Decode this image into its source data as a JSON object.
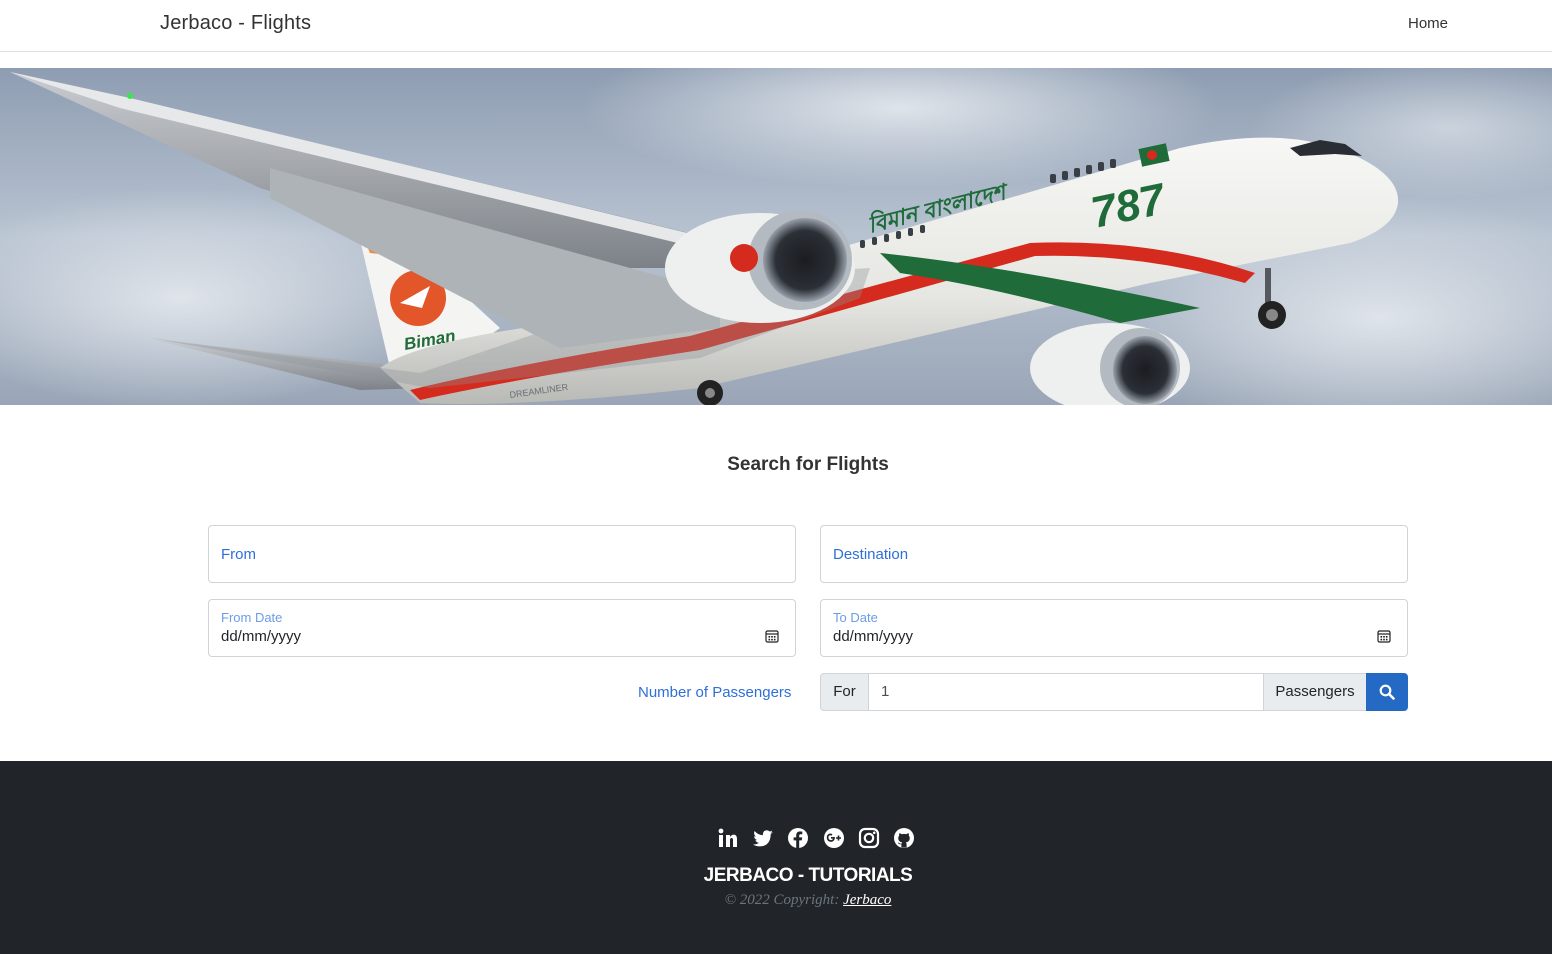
{
  "navbar": {
    "brand": "Jerbaco - Flights",
    "home_label": "Home"
  },
  "hero": {
    "tail_text": "Biman",
    "fuselage_text": "বিমান বাংলাদেশ",
    "model_text": "787",
    "engine_text": "DREAMLINER"
  },
  "search": {
    "title": "Search for Flights",
    "from_placeholder": "From",
    "destination_placeholder": "Destination",
    "from_date_label": "From Date",
    "from_date_value": "dd/mm/yyyy",
    "to_date_label": "To Date",
    "to_date_value": "dd/mm/yyyy",
    "passengers_label": "Number of Passengers",
    "for_label": "For",
    "passengers_value": "1",
    "passengers_suffix": "Passengers",
    "search_icon": "search-icon"
  },
  "footer": {
    "social_icons": [
      "linkedin-icon",
      "twitter-icon",
      "facebook-icon",
      "google-plus-icon",
      "instagram-icon",
      "github-icon"
    ],
    "title": "JERBACO - TUTORIALS",
    "copyright_prefix": "© 2022 Copyright:",
    "copyright_link": "Jerbaco"
  },
  "colors": {
    "accent": "#2f6fd8",
    "button": "#2469c4",
    "footer_bg": "#212529",
    "biman_red": "#d52b1e",
    "biman_green": "#1f6b3a"
  }
}
